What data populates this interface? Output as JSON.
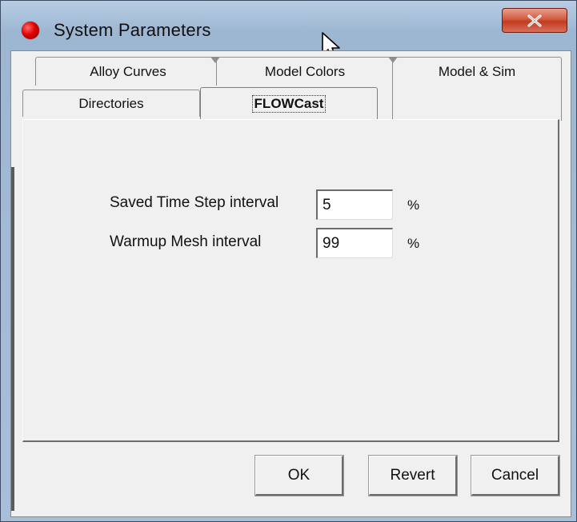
{
  "window": {
    "title": "System Parameters",
    "close_label": "x"
  },
  "tabs": {
    "row1": [
      {
        "label": "Alloy Curves"
      },
      {
        "label": "Model Colors"
      },
      {
        "label": "Model & Sim"
      }
    ],
    "row2": [
      {
        "label": "Directories"
      },
      {
        "label": "FLOWCast",
        "selected": true
      }
    ]
  },
  "form": {
    "saved_time_step": {
      "label": "Saved Time Step interval",
      "value": "5",
      "unit": "%"
    },
    "warmup_mesh": {
      "label": "Warmup Mesh interval",
      "value": "99",
      "unit": "%"
    }
  },
  "buttons": {
    "ok": "OK",
    "revert": "Revert",
    "cancel": "Cancel"
  },
  "colors": {
    "title_icon": "#e00000",
    "close_button": "#c8452a",
    "dialog_face": "#f0f0f0"
  }
}
